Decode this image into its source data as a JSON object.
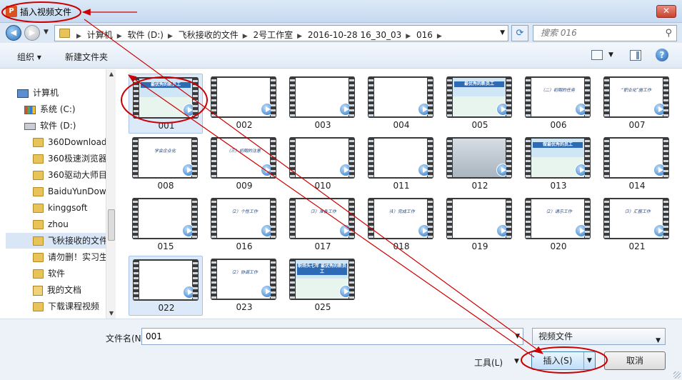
{
  "window": {
    "title": "插入视频文件",
    "close_label": "✕",
    "app_icon_label": "P"
  },
  "address": {
    "crumbs": [
      "计算机",
      "软件 (D:)",
      "飞秋接收的文件",
      "2号工作室",
      "2016-10-28 16_30_03",
      "016"
    ],
    "search_placeholder": "搜索 016"
  },
  "toolbar": {
    "organize": "组织 ▾",
    "new_folder": "新建文件夹"
  },
  "sidebar": {
    "items": [
      {
        "label": "计算机",
        "icon": "computer-icon"
      },
      {
        "label": "系统 (C:)",
        "icon": "drive-c-icon"
      },
      {
        "label": "软件 (D:)",
        "icon": "drive-d-icon"
      },
      {
        "label": "360Download",
        "icon": "folder-icon"
      },
      {
        "label": "360极速浏览器",
        "icon": "folder-icon"
      },
      {
        "label": "360驱动大师目",
        "icon": "folder-icon"
      },
      {
        "label": "BaiduYunDow",
        "icon": "folder-icon"
      },
      {
        "label": "kinggsoft",
        "icon": "folder-icon"
      },
      {
        "label": "zhou",
        "icon": "folder-icon"
      },
      {
        "label": "飞秋接收的文件",
        "icon": "folder-icon",
        "selected": true
      },
      {
        "label": "请勿删！实习生",
        "icon": "folder-icon"
      },
      {
        "label": "软件",
        "icon": "folder-icon"
      },
      {
        "label": "我的文档",
        "icon": "documents-icon"
      },
      {
        "label": "下载课程视频",
        "icon": "folder-icon"
      }
    ]
  },
  "files": [
    {
      "name": "001",
      "slide_text": "最优秀的新员工",
      "style": "blue",
      "selected": true
    },
    {
      "name": "002",
      "slide_text": "",
      "style": "white"
    },
    {
      "name": "003",
      "slide_text": "",
      "style": "white"
    },
    {
      "name": "004",
      "slide_text": "",
      "style": "white"
    },
    {
      "name": "005",
      "slide_text": "最优秀的新员工",
      "style": "blue"
    },
    {
      "name": "006",
      "slide_text": "（二）初期的任务",
      "style": "white"
    },
    {
      "name": "007",
      "slide_text": "“职业化”施工作",
      "style": "white"
    },
    {
      "name": "008",
      "slide_text": "学会企业化",
      "style": "white"
    },
    {
      "name": "009",
      "slide_text": "（三）初期的注意",
      "style": "white"
    },
    {
      "name": "010",
      "slide_text": "",
      "style": "white"
    },
    {
      "name": "011",
      "slide_text": "",
      "style": "white"
    },
    {
      "name": "012",
      "slide_text": "",
      "style": "gray"
    },
    {
      "name": "013",
      "slide_text": "做最优秀的员工",
      "style": "blue"
    },
    {
      "name": "014",
      "slide_text": "",
      "style": "white"
    },
    {
      "name": "015",
      "slide_text": "",
      "style": "white"
    },
    {
      "name": "016",
      "slide_text": "（2）个性工作",
      "style": "white"
    },
    {
      "name": "017",
      "slide_text": "（3）准备工作",
      "style": "white"
    },
    {
      "name": "018",
      "slide_text": "（4）完成工作",
      "style": "white"
    },
    {
      "name": "019",
      "slide_text": "",
      "style": "white"
    },
    {
      "name": "020",
      "slide_text": "（2）请示工作",
      "style": "white"
    },
    {
      "name": "021",
      "slide_text": "（3）汇报工作",
      "style": "white"
    },
    {
      "name": "022",
      "slide_text": "",
      "style": "white",
      "selected": true
    },
    {
      "name": "023",
      "slide_text": "（2）协调工作",
      "style": "white"
    },
    {
      "name": "025",
      "slide_text": "职场头七年 最优秀的新员工",
      "style": "blue"
    }
  ],
  "bottom": {
    "filename_label": "文件名(N):",
    "filename_value": "001",
    "filetype_value": "视频文件",
    "tools_label": "工具(L)",
    "insert_label": "插入(S)",
    "cancel_label": "取消"
  },
  "colors": {
    "annotation": "#cc0000",
    "accent": "#2a74c7"
  }
}
